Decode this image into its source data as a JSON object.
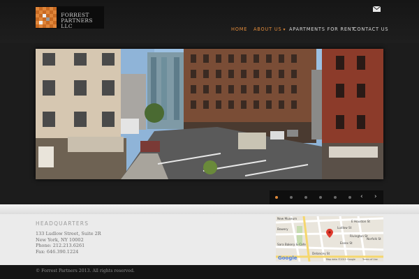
{
  "brand": {
    "logo_text_line1": "FORREST",
    "logo_text_line2": "PARTNERS LLC",
    "logo_colors": [
      "#e0863a",
      "#c86a22",
      "#efefef",
      "#9a9a9a"
    ]
  },
  "header_icons": {
    "mail": "envelope-icon"
  },
  "nav": {
    "items": [
      {
        "label": "HOME",
        "active": true
      },
      {
        "label": "ABOUT US",
        "active": true,
        "has_dropdown": true,
        "dropdown_glyph": "▾"
      },
      {
        "label": "APARTMENTS FOR RENT",
        "active": false
      },
      {
        "label": "CONTACT US",
        "active": false
      }
    ],
    "accent_color": "#e08a3a"
  },
  "slider": {
    "image_description": "street view photo",
    "slide_count": 6,
    "current_slide": 1,
    "prev_glyph": "‹",
    "next_glyph": "›"
  },
  "headquarters": {
    "title": "HEADQUARTERS",
    "street": "133 Ludlow Street, Suite 2R",
    "city": "New York, NY 10002",
    "phone": "Phone: 212.213.6261",
    "fax": "Fax: 646.390.1224"
  },
  "map": {
    "labels": {
      "museum": "New Museum",
      "bowery": "Bowery",
      "bakery": "Sara Bakery & Cafe",
      "delancey": "Delancey St",
      "essex": "Essex St",
      "e_houston": "E Houston St",
      "norfolk": "Norfolk St",
      "rivington": "Rivington St",
      "ludlow": "Ludlow St",
      "attribution": "Map data ©2015 Google",
      "terms": "Terms of Use",
      "google": "Google"
    }
  },
  "footer": {
    "copyright": "© Forrest Partners 2013. All rights reserved."
  }
}
